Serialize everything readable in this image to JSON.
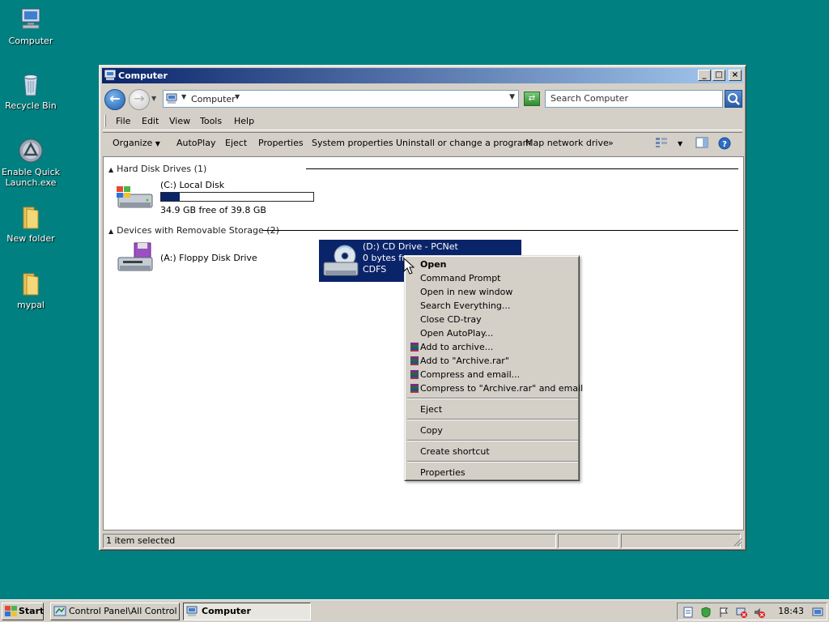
{
  "desktop": {
    "icons": [
      {
        "label": "Computer",
        "icon": "computer-icon"
      },
      {
        "label": "Recycle Bin",
        "icon": "recycle-bin-icon"
      },
      {
        "label": "Enable Quick Launch.exe",
        "icon": "quick-launch-icon"
      },
      {
        "label": "New folder",
        "icon": "folder-icon"
      },
      {
        "label": "mypal",
        "icon": "folder-icon"
      }
    ]
  },
  "window": {
    "title": "Computer",
    "address": {
      "location": "Computer"
    },
    "search": {
      "placeholder": "Search Computer"
    },
    "menu": [
      "File",
      "Edit",
      "View",
      "Tools",
      "Help"
    ],
    "commands": [
      "Organize",
      "AutoPlay",
      "Eject",
      "Properties",
      "System properties",
      "Uninstall or change a program",
      "Map network drive",
      "»"
    ],
    "groups": {
      "hard_disk": {
        "header": "Hard Disk Drives (1)",
        "drives": [
          {
            "name": "(C:) Local Disk",
            "free": "34.9 GB free of 39.8 GB",
            "used_fraction": 0.12
          }
        ]
      },
      "removable": {
        "header": "Devices with Removable Storage (2)",
        "drives": [
          {
            "name": "(A:) Floppy Disk Drive"
          },
          {
            "name": "(D:) CD Drive - PCNet",
            "free": "0 bytes fr",
            "fs": "CDFS"
          }
        ]
      }
    },
    "status": "1 item selected"
  },
  "context_menu": {
    "items": [
      {
        "label": "Open",
        "bold": true
      },
      {
        "label": "Command Prompt"
      },
      {
        "label": "Open in new window"
      },
      {
        "label": "Search Everything..."
      },
      {
        "label": "Close CD-tray"
      },
      {
        "label": "Open AutoPlay..."
      },
      {
        "label": "Add to archive...",
        "icon": "winrar-icon"
      },
      {
        "label": "Add to \"Archive.rar\"",
        "icon": "winrar-icon"
      },
      {
        "label": "Compress and email...",
        "icon": "winrar-icon"
      },
      {
        "label": "Compress to \"Archive.rar\" and email",
        "icon": "winrar-icon"
      },
      {
        "label": "Eject"
      },
      {
        "label": "Copy"
      },
      {
        "label": "Create shortcut"
      },
      {
        "label": "Properties"
      }
    ]
  },
  "taskbar": {
    "start": "Start",
    "tasks": [
      {
        "label": "Control Panel\\All Control ..."
      },
      {
        "label": "Computer",
        "active": true
      }
    ],
    "clock": "18:43"
  }
}
